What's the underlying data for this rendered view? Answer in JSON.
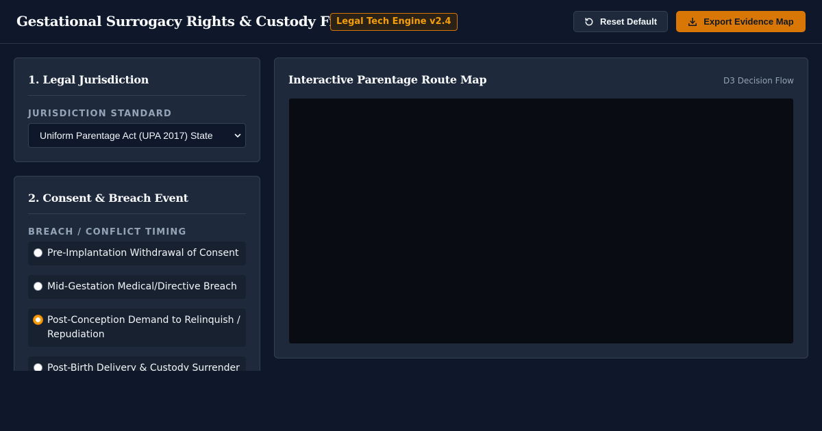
{
  "header": {
    "title": "Gestational Surrogacy Rights & Custody Framework",
    "badge": "Legal Tech Engine v2.4",
    "reset_label": "Reset Default",
    "export_label": "Export Evidence Map"
  },
  "jurisdiction": {
    "title": "1. Legal Jurisdiction",
    "field_label": "JURISDICTION STANDARD",
    "selected": "Uniform Parentage Act (UPA 2017) State"
  },
  "consent": {
    "title": "2. Consent & Breach Event",
    "field_label": "BREACH / CONFLICT TIMING",
    "options": [
      {
        "label": "Pre-Implantation Withdrawal of Consent",
        "checked": false
      },
      {
        "label": "Mid-Gestation Medical/Directive Breach",
        "checked": false
      },
      {
        "label": "Post-Conception Demand to Relinquish / Repudiation",
        "checked": true
      },
      {
        "label": "Post-Birth Delivery & Custody Surrender",
        "checked": false
      }
    ]
  },
  "map": {
    "title": "Interactive Parentage Route Map",
    "subtitle": "D3 Decision Flow"
  },
  "colors": {
    "accent": "#d97706",
    "background": "#0f172a",
    "panel": "#1e293b"
  },
  "icons": {
    "reset": "reset-icon",
    "export": "download-icon",
    "select": "chevron-down-icon"
  }
}
